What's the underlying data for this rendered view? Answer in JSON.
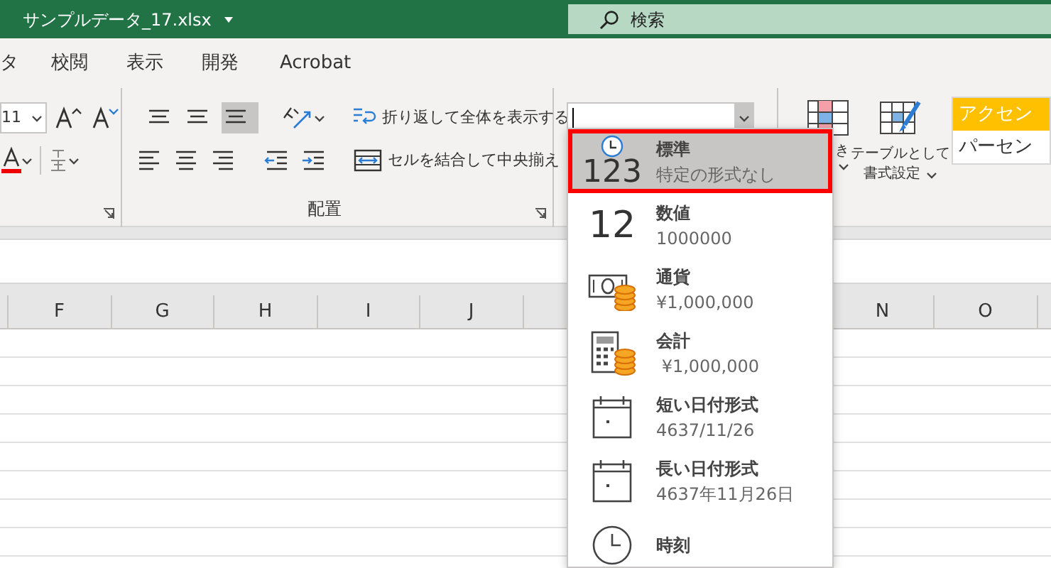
{
  "title_bar": {
    "file_name": "サンプルデータ_17.xlsx",
    "search_placeholder": "検索"
  },
  "ribbon_tabs": [
    {
      "label": "タ",
      "selected": false
    },
    {
      "label": "校閲",
      "selected": false
    },
    {
      "label": "表示",
      "selected": false
    },
    {
      "label": "開発",
      "selected": false
    },
    {
      "label": "Acrobat",
      "selected": false
    }
  ],
  "font_group": {
    "font_size": "11"
  },
  "alignment_group": {
    "label": "配置",
    "vertical_alignment": [
      {
        "selected": false
      },
      {
        "selected": false
      },
      {
        "selected": true
      }
    ],
    "wrap_text": "折り返して全体を表示する",
    "merge_center": "セルを結合して中央揃え"
  },
  "styles_group": {
    "conditional_format_fragment": "き",
    "table_format": [
      "テーブルとして",
      "書式設定"
    ],
    "cell_styles": [
      {
        "label": "アクセン",
        "color": "#ffc000"
      },
      {
        "label": "パーセン",
        "color": "#ffffff"
      }
    ]
  },
  "column_headers_left": [
    "F",
    "G",
    "H",
    "I",
    "J"
  ],
  "column_headers_right": [
    "N",
    "O"
  ],
  "number_format_menu": {
    "items": [
      {
        "kind": "general",
        "icon_text": "123",
        "label": "標準",
        "example": "特定の形式なし",
        "selected": true
      },
      {
        "kind": "number",
        "icon_text": "12",
        "label": "数値",
        "example": "1000000",
        "selected": false
      },
      {
        "kind": "currency",
        "label": "通貨",
        "example": "¥1,000,000",
        "selected": false
      },
      {
        "kind": "accounting",
        "label": "会計",
        "example": " ¥1,000,000",
        "selected": false
      },
      {
        "kind": "short_date",
        "label": "短い日付形式",
        "example": "4637/11/26",
        "selected": false
      },
      {
        "kind": "long_date",
        "label": "長い日付形式",
        "example": "4637年11月26日",
        "selected": false
      },
      {
        "kind": "time",
        "label": "時刻",
        "selected": false
      }
    ]
  }
}
